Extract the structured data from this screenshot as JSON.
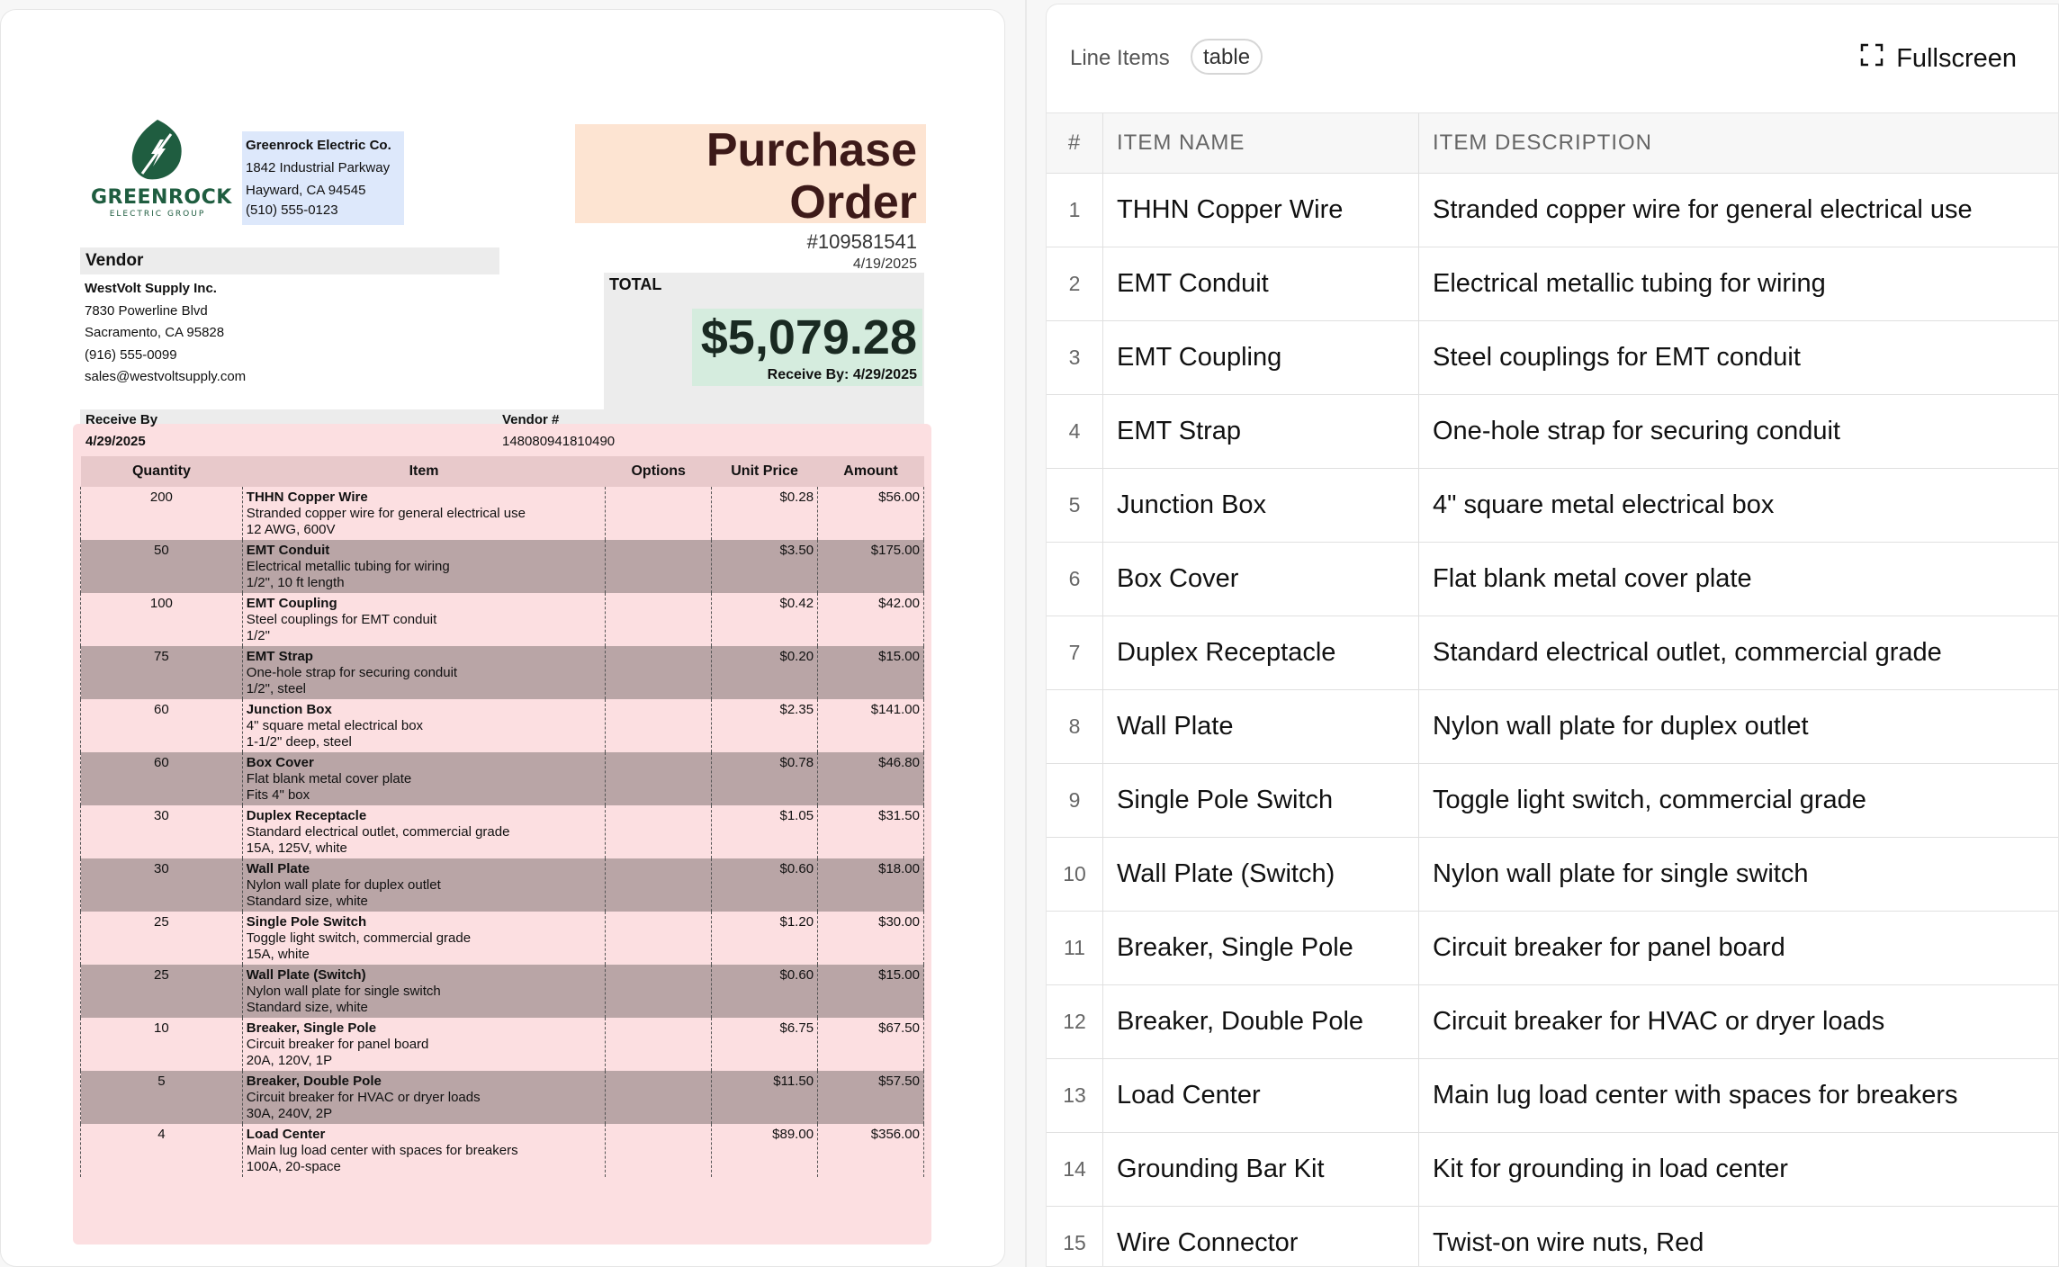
{
  "company": {
    "logo_text": "GREENROCK",
    "logo_subtext": "ELECTRIC GROUP",
    "name": "Greenrock Electric Co.",
    "address1": "1842 Industrial Parkway",
    "address2": "Hayward, CA 94545",
    "phone": "(510) 555-0123"
  },
  "po": {
    "title": "Purchase Order",
    "number": "#109581541",
    "date": "4/19/2025"
  },
  "vendor": {
    "heading": "Vendor",
    "name": "WestVolt Supply Inc.",
    "address1": "7830 Powerline Blvd",
    "address2": "Sacramento, CA 95828",
    "phone": "(916) 555-0099",
    "email": "sales@westvoltsupply.com"
  },
  "total": {
    "label": "TOTAL",
    "amount": "$5,079.28",
    "receive_by": "Receive By: 4/29/2025"
  },
  "meta": {
    "receive_by_label": "Receive By",
    "receive_by_value": "4/29/2025",
    "vendor_num_label": "Vendor #",
    "vendor_num_value": "148080941810490"
  },
  "doc_table": {
    "headers": [
      "Quantity",
      "Item",
      "Options",
      "Unit Price",
      "Amount"
    ],
    "rows": [
      {
        "qty": "200",
        "name": "THHN Copper Wire",
        "desc": "Stranded copper wire for general electrical use",
        "spec": "12 AWG, 600V",
        "options": "",
        "unit": "$0.28",
        "amount": "$56.00"
      },
      {
        "qty": "50",
        "name": "EMT Conduit",
        "desc": "Electrical metallic tubing for wiring",
        "spec": "1/2\", 10 ft length",
        "options": "",
        "unit": "$3.50",
        "amount": "$175.00"
      },
      {
        "qty": "100",
        "name": "EMT Coupling",
        "desc": "Steel couplings for EMT conduit",
        "spec": "1/2\"",
        "options": "",
        "unit": "$0.42",
        "amount": "$42.00"
      },
      {
        "qty": "75",
        "name": "EMT Strap",
        "desc": "One-hole strap for securing conduit",
        "spec": "1/2\", steel",
        "options": "",
        "unit": "$0.20",
        "amount": "$15.00"
      },
      {
        "qty": "60",
        "name": "Junction Box",
        "desc": "4\" square metal electrical box",
        "spec": "1-1/2\" deep, steel",
        "options": "",
        "unit": "$2.35",
        "amount": "$141.00"
      },
      {
        "qty": "60",
        "name": "Box Cover",
        "desc": "Flat blank metal cover plate",
        "spec": "Fits 4\" box",
        "options": "",
        "unit": "$0.78",
        "amount": "$46.80"
      },
      {
        "qty": "30",
        "name": "Duplex Receptacle",
        "desc": "Standard electrical outlet, commercial grade",
        "spec": "15A, 125V, white",
        "options": "",
        "unit": "$1.05",
        "amount": "$31.50"
      },
      {
        "qty": "30",
        "name": "Wall Plate",
        "desc": "Nylon wall plate for duplex outlet",
        "spec": "Standard size, white",
        "options": "",
        "unit": "$0.60",
        "amount": "$18.00"
      },
      {
        "qty": "25",
        "name": "Single Pole Switch",
        "desc": "Toggle light switch, commercial grade",
        "spec": "15A, white",
        "options": "",
        "unit": "$1.20",
        "amount": "$30.00"
      },
      {
        "qty": "25",
        "name": "Wall Plate (Switch)",
        "desc": "Nylon wall plate for single switch",
        "spec": "Standard size, white",
        "options": "",
        "unit": "$0.60",
        "amount": "$15.00"
      },
      {
        "qty": "10",
        "name": "Breaker, Single Pole",
        "desc": "Circuit breaker for panel board",
        "spec": "20A, 120V, 1P",
        "options": "",
        "unit": "$6.75",
        "amount": "$67.50"
      },
      {
        "qty": "5",
        "name": "Breaker, Double Pole",
        "desc": "Circuit breaker for HVAC or dryer loads",
        "spec": "30A, 240V, 2P",
        "options": "",
        "unit": "$11.50",
        "amount": "$57.50"
      },
      {
        "qty": "4",
        "name": "Load Center",
        "desc": "Main lug load center with spaces for breakers",
        "spec": "100A, 20-space",
        "options": "",
        "unit": "$89.00",
        "amount": "$356.00"
      }
    ]
  },
  "panel": {
    "title": "Line Items",
    "badge": "table",
    "fullscreen_label": "Fullscreen",
    "fullscreen_icon": "expand-icon",
    "headers": [
      "#",
      "ITEM NAME",
      "ITEM DESCRIPTION"
    ],
    "rows": [
      {
        "idx": "1",
        "name": "THHN Copper Wire",
        "desc": "Stranded copper wire for general electrical use"
      },
      {
        "idx": "2",
        "name": "EMT Conduit",
        "desc": "Electrical metallic tubing for wiring"
      },
      {
        "idx": "3",
        "name": "EMT Coupling",
        "desc": "Steel couplings for EMT conduit"
      },
      {
        "idx": "4",
        "name": "EMT Strap",
        "desc": "One-hole strap for securing conduit"
      },
      {
        "idx": "5",
        "name": "Junction Box",
        "desc": "4\" square metal electrical box"
      },
      {
        "idx": "6",
        "name": "Box Cover",
        "desc": "Flat blank metal cover plate"
      },
      {
        "idx": "7",
        "name": "Duplex Receptacle",
        "desc": "Standard electrical outlet, commercial grade"
      },
      {
        "idx": "8",
        "name": "Wall Plate",
        "desc": "Nylon wall plate for duplex outlet"
      },
      {
        "idx": "9",
        "name": "Single Pole Switch",
        "desc": "Toggle light switch, commercial grade"
      },
      {
        "idx": "10",
        "name": "Wall Plate (Switch)",
        "desc": "Nylon wall plate for single switch"
      },
      {
        "idx": "11",
        "name": "Breaker, Single Pole",
        "desc": "Circuit breaker for panel board"
      },
      {
        "idx": "12",
        "name": "Breaker, Double Pole",
        "desc": "Circuit breaker for HVAC or dryer loads"
      },
      {
        "idx": "13",
        "name": "Load Center",
        "desc": "Main lug load center with spaces for breakers"
      },
      {
        "idx": "14",
        "name": "Grounding Bar Kit",
        "desc": "Kit for grounding in load center"
      },
      {
        "idx": "15",
        "name": "Wire Connector",
        "desc": "Twist-on wire nuts, Red"
      }
    ]
  },
  "colors": {
    "brand_green": "#1f5d40",
    "po_title": "#3d1a19",
    "table_pink": "#fcdfe1",
    "row_shade": "#b9a5a6"
  }
}
